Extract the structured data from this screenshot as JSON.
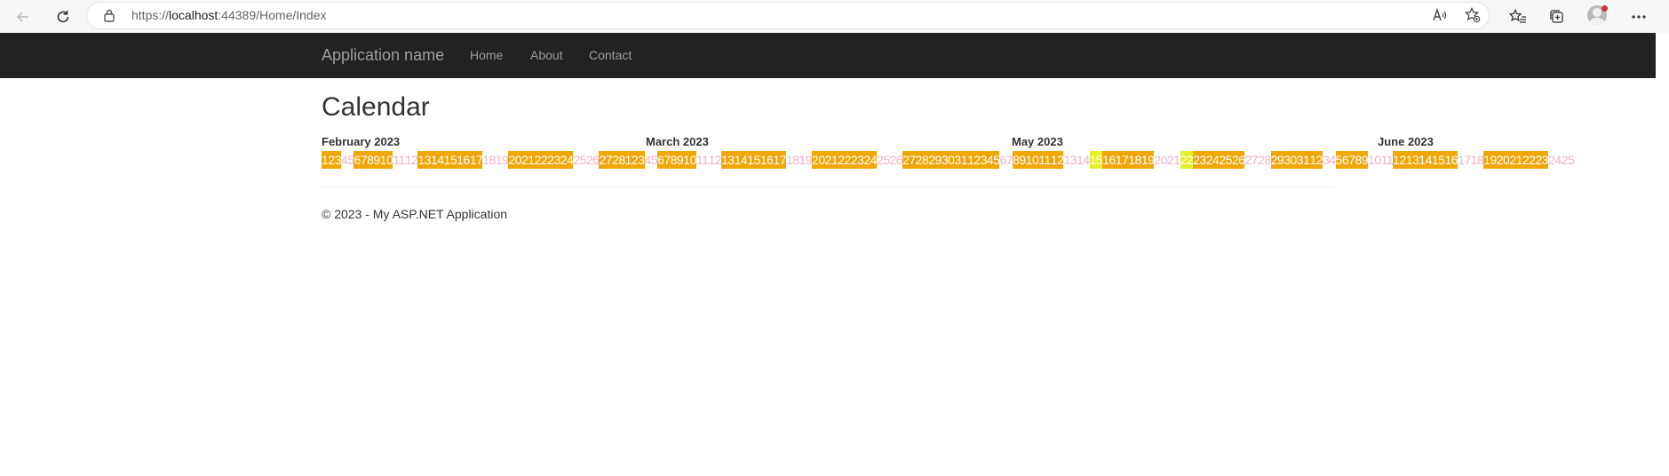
{
  "browser": {
    "url_prefix": "https://",
    "url_host": "localhost",
    "url_rest": ":44389/Home/Index"
  },
  "app": {
    "brand": "Application name",
    "nav": [
      {
        "label": "Home"
      },
      {
        "label": "About"
      },
      {
        "label": "Contact"
      }
    ]
  },
  "page": {
    "title": "Calendar",
    "footer": "© 2023 - My ASP.NET Application"
  },
  "colors": {
    "highlight": "#F0A70A",
    "today": "#E4F02B",
    "plain_text": "#F3B0C8",
    "navbar": "#222222"
  },
  "calendar": {
    "months": [
      {
        "title": "February 2023"
      },
      {
        "title": "March 2023"
      },
      {
        "title": "May 2023"
      },
      {
        "title": "June 2023"
      }
    ],
    "days": [
      {
        "t": "1",
        "s": "h"
      },
      {
        "t": "2",
        "s": "h"
      },
      {
        "t": "3",
        "s": "h"
      },
      {
        "t": "4",
        "s": "p"
      },
      {
        "t": "5",
        "s": "p"
      },
      {
        "t": "6",
        "s": "h"
      },
      {
        "t": "7",
        "s": "h"
      },
      {
        "t": "8",
        "s": "h"
      },
      {
        "t": "9",
        "s": "h"
      },
      {
        "t": "10",
        "s": "h"
      },
      {
        "t": "11",
        "s": "p"
      },
      {
        "t": "12",
        "s": "p"
      },
      {
        "t": "13",
        "s": "h"
      },
      {
        "t": "14",
        "s": "h"
      },
      {
        "t": "15",
        "s": "h"
      },
      {
        "t": "16",
        "s": "h"
      },
      {
        "t": "17",
        "s": "h"
      },
      {
        "t": "18",
        "s": "p"
      },
      {
        "t": "19",
        "s": "p"
      },
      {
        "t": "20",
        "s": "h"
      },
      {
        "t": "21",
        "s": "h"
      },
      {
        "t": "22",
        "s": "h"
      },
      {
        "t": "23",
        "s": "h"
      },
      {
        "t": "24",
        "s": "h"
      },
      {
        "t": "25",
        "s": "p"
      },
      {
        "t": "26",
        "s": "p"
      },
      {
        "t": "27",
        "s": "h"
      },
      {
        "t": "28",
        "s": "h"
      },
      {
        "t": "1",
        "s": "h"
      },
      {
        "t": "2",
        "s": "h"
      },
      {
        "t": "3",
        "s": "h"
      },
      {
        "t": "4",
        "s": "p"
      },
      {
        "t": "5",
        "s": "p"
      },
      {
        "t": "6",
        "s": "h"
      },
      {
        "t": "7",
        "s": "h"
      },
      {
        "t": "8",
        "s": "h"
      },
      {
        "t": "9",
        "s": "h"
      },
      {
        "t": "10",
        "s": "h"
      },
      {
        "t": "11",
        "s": "p"
      },
      {
        "t": "12",
        "s": "p"
      },
      {
        "t": "13",
        "s": "h"
      },
      {
        "t": "14",
        "s": "h"
      },
      {
        "t": "15",
        "s": "h"
      },
      {
        "t": "16",
        "s": "h"
      },
      {
        "t": "17",
        "s": "h"
      },
      {
        "t": "18",
        "s": "p"
      },
      {
        "t": "19",
        "s": "p"
      },
      {
        "t": "20",
        "s": "h"
      },
      {
        "t": "21",
        "s": "h"
      },
      {
        "t": "22",
        "s": "h"
      },
      {
        "t": "23",
        "s": "h"
      },
      {
        "t": "24",
        "s": "h"
      },
      {
        "t": "25",
        "s": "p"
      },
      {
        "t": "26",
        "s": "p"
      },
      {
        "t": "27",
        "s": "h"
      },
      {
        "t": "28",
        "s": "h"
      },
      {
        "t": "29",
        "s": "h"
      },
      {
        "t": "30",
        "s": "h"
      },
      {
        "t": "31",
        "s": "h"
      },
      {
        "t": "1",
        "s": "h"
      },
      {
        "t": "2",
        "s": "h"
      },
      {
        "t": "3",
        "s": "h"
      },
      {
        "t": "4",
        "s": "h"
      },
      {
        "t": "5",
        "s": "h"
      },
      {
        "t": "6",
        "s": "p"
      },
      {
        "t": "7",
        "s": "p"
      },
      {
        "t": "8",
        "s": "h"
      },
      {
        "t": "9",
        "s": "h"
      },
      {
        "t": "10",
        "s": "h"
      },
      {
        "t": "11",
        "s": "h"
      },
      {
        "t": "12",
        "s": "h"
      },
      {
        "t": "13",
        "s": "p"
      },
      {
        "t": "14",
        "s": "p"
      },
      {
        "t": "15",
        "s": "y"
      },
      {
        "t": "16",
        "s": "h"
      },
      {
        "t": "17",
        "s": "h"
      },
      {
        "t": "18",
        "s": "h"
      },
      {
        "t": "19",
        "s": "h"
      },
      {
        "t": "20",
        "s": "p"
      },
      {
        "t": "21",
        "s": "p"
      },
      {
        "t": "22",
        "s": "y"
      },
      {
        "t": "23",
        "s": "h"
      },
      {
        "t": "24",
        "s": "h"
      },
      {
        "t": "25",
        "s": "h"
      },
      {
        "t": "26",
        "s": "h"
      },
      {
        "t": "27",
        "s": "p"
      },
      {
        "t": "28",
        "s": "p"
      },
      {
        "t": "29",
        "s": "h"
      },
      {
        "t": "30",
        "s": "h"
      },
      {
        "t": "31",
        "s": "h"
      },
      {
        "t": "1",
        "s": "h"
      },
      {
        "t": "2",
        "s": "h"
      },
      {
        "t": "3",
        "s": "p"
      },
      {
        "t": "4",
        "s": "p"
      },
      {
        "t": "5",
        "s": "h"
      },
      {
        "t": "6",
        "s": "h"
      },
      {
        "t": "7",
        "s": "h"
      },
      {
        "t": "8",
        "s": "h"
      },
      {
        "t": "9",
        "s": "h"
      },
      {
        "t": "10",
        "s": "p"
      },
      {
        "t": "11",
        "s": "p"
      },
      {
        "t": "12",
        "s": "h"
      },
      {
        "t": "13",
        "s": "h"
      },
      {
        "t": "14",
        "s": "h"
      },
      {
        "t": "15",
        "s": "h"
      },
      {
        "t": "16",
        "s": "h"
      },
      {
        "t": "17",
        "s": "p"
      },
      {
        "t": "18",
        "s": "p"
      },
      {
        "t": "19",
        "s": "h"
      },
      {
        "t": "20",
        "s": "h"
      },
      {
        "t": "21",
        "s": "h"
      },
      {
        "t": "22",
        "s": "h"
      },
      {
        "t": "23",
        "s": "h"
      },
      {
        "t": "24",
        "s": "p"
      },
      {
        "t": "25",
        "s": "p"
      }
    ]
  }
}
